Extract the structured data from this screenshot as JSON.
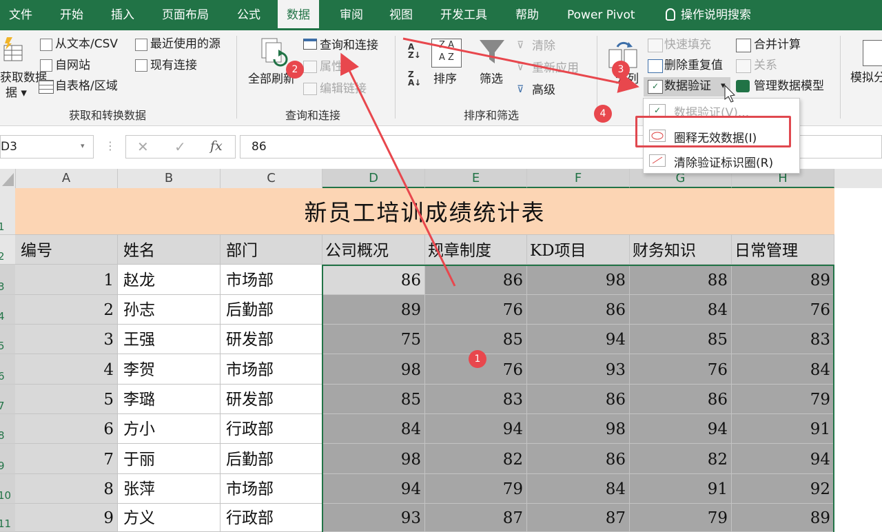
{
  "tabs": [
    "文件",
    "开始",
    "插入",
    "页面布局",
    "公式",
    "数据",
    "审阅",
    "视图",
    "开发工具",
    "帮助",
    "Power Pivot",
    "操作说明搜索"
  ],
  "active_tab": "数据",
  "ribbon": {
    "get_data_label": "获取数据",
    "get_data_label2": "据",
    "from_text_csv": "从文本/CSV",
    "from_web": "自网站",
    "from_table": "自表格/区域",
    "recent_sources": "最近使用的源",
    "existing_connections": "现有连接",
    "group_get_transform": "获取和转换数据",
    "refresh_all": "全部刷新",
    "queries_connections": "查询和连接",
    "properties": "属性",
    "edit_links": "编辑链接",
    "group_queries": "查询和连接",
    "sort": "排序",
    "filter": "筛选",
    "clear": "清除",
    "reapply": "重新应用",
    "advanced": "高级",
    "group_sort_filter": "排序和筛选",
    "text_to_columns": "分列",
    "flash_fill": "快速填充",
    "remove_duplicates": "删除重复值",
    "data_validation": "数据验证",
    "consolidate": "合并计算",
    "relationships": "关系",
    "manage_data_model": "管理数据模型",
    "what_if": "模拟分"
  },
  "dropdown": {
    "items": [
      "数据验证(V)...",
      "圈释无效数据(I)",
      "清除验证标识圈(R)"
    ]
  },
  "formula_bar": {
    "name_box": "D3",
    "fx": "fx",
    "value": "86"
  },
  "columns": [
    "A",
    "B",
    "C",
    "D",
    "E",
    "F",
    "G",
    "H"
  ],
  "row_numbers": [
    "1",
    "2",
    "3",
    "4",
    "5",
    "6",
    "7",
    "8",
    "9",
    "10",
    "11"
  ],
  "sheet": {
    "title": "新员工培训成绩统计表",
    "headers": [
      "编号",
      "姓名",
      "部门",
      "公司概况",
      "规章制度",
      "KD项目",
      "财务知识",
      "日常管理"
    ],
    "rows": [
      [
        "1",
        "赵龙",
        "市场部",
        "86",
        "86",
        "98",
        "88",
        "89"
      ],
      [
        "2",
        "孙志",
        "后勤部",
        "89",
        "76",
        "86",
        "84",
        "76"
      ],
      [
        "3",
        "王强",
        "研发部",
        "75",
        "85",
        "94",
        "85",
        "83"
      ],
      [
        "4",
        "李贺",
        "市场部",
        "98",
        "76",
        "93",
        "76",
        "84"
      ],
      [
        "5",
        "李璐",
        "研发部",
        "85",
        "83",
        "86",
        "86",
        "79"
      ],
      [
        "6",
        "方小",
        "行政部",
        "84",
        "94",
        "98",
        "94",
        "91"
      ],
      [
        "7",
        "于丽",
        "后勤部",
        "98",
        "82",
        "86",
        "82",
        "94"
      ],
      [
        "8",
        "张萍",
        "市场部",
        "94",
        "79",
        "84",
        "91",
        "92"
      ],
      [
        "9",
        "方义",
        "行政部",
        "93",
        "87",
        "87",
        "79",
        "89"
      ]
    ]
  },
  "callouts": [
    "1",
    "2",
    "3",
    "4"
  ],
  "colors": {
    "accent": "#217346",
    "title_fill": "#fcd5b4",
    "selection": "#a6a6a6",
    "callout": "#e8474d"
  }
}
